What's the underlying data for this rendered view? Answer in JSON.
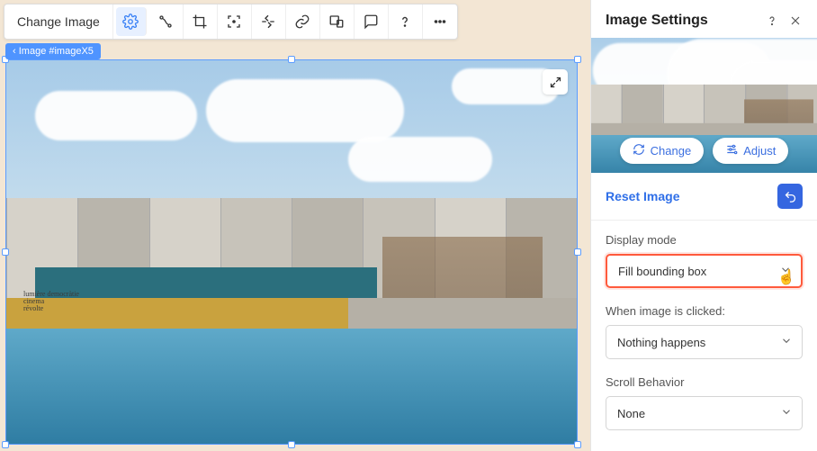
{
  "toolbar": {
    "change_image": "Change Image"
  },
  "breadcrumb": {
    "label": "Image #imageX5"
  },
  "panel": {
    "title": "Image Settings",
    "change_btn": "Change",
    "adjust_btn": "Adjust",
    "reset_link": "Reset Image",
    "display_mode": {
      "label": "Display mode",
      "value": "Fill bounding box"
    },
    "on_click": {
      "label": "When image is clicked:",
      "value": "Nothing happens"
    },
    "scroll": {
      "label": "Scroll Behavior",
      "value": "None"
    }
  }
}
